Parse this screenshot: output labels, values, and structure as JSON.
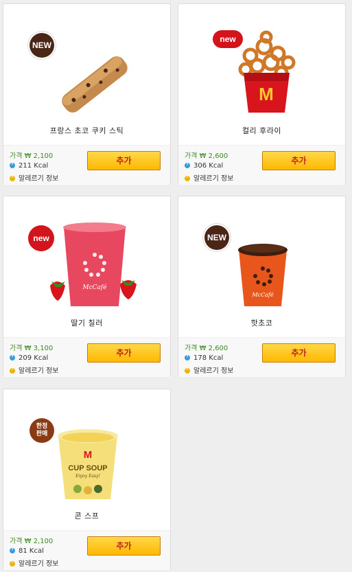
{
  "add_label": "추가",
  "allergy_label": "알레르기 정보",
  "price_prefix": "가격 ₩",
  "kcal_suffix": "Kcal",
  "items": [
    {
      "name": "프랑스 초코 쿠키 스틱",
      "price": "2,100",
      "kcal": "211",
      "badge": "NEW",
      "badge_style": "brown"
    },
    {
      "name": "컬리 후라이",
      "price": "2,600",
      "kcal": "306",
      "badge": "new",
      "badge_style": "red-pill"
    },
    {
      "name": "딸기 칠러",
      "price": "3,100",
      "kcal": "209",
      "badge": "new",
      "badge_style": "red-round"
    },
    {
      "name": "핫초코",
      "price": "2,600",
      "kcal": "178",
      "badge": "NEW",
      "badge_style": "brown"
    },
    {
      "name": "콘 스프",
      "price": "2,100",
      "kcal": "81",
      "badge": "한정\n판매",
      "badge_style": "limited"
    }
  ],
  "colors": {
    "price": "#3a8a1c",
    "button": "#ffc21a",
    "button_text": "#c01f1f"
  }
}
